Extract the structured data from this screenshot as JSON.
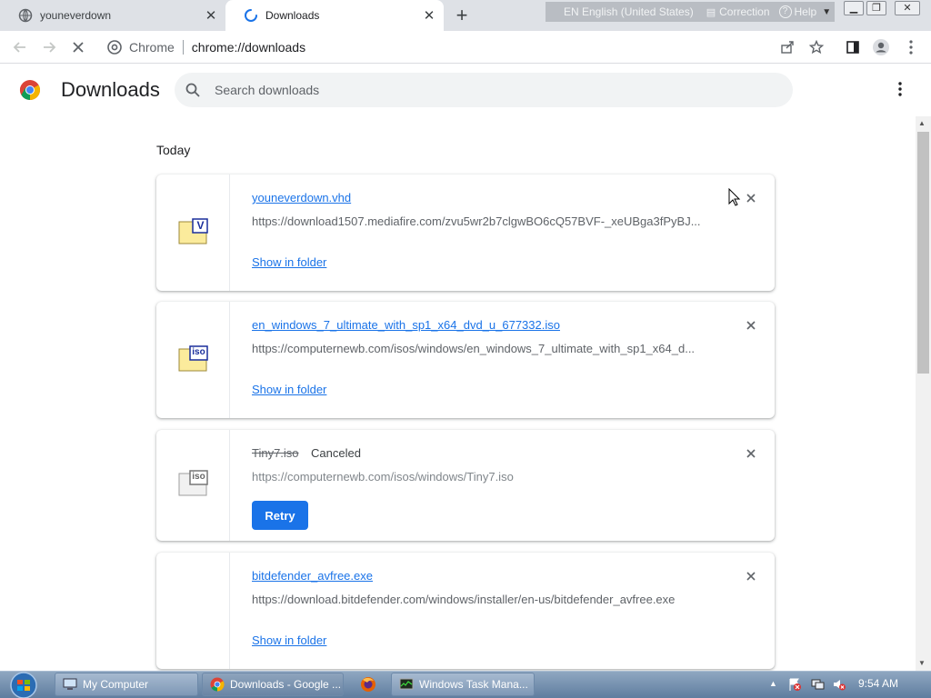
{
  "tabs": [
    {
      "title": "youneverdown",
      "active": false
    },
    {
      "title": "Downloads",
      "active": true
    }
  ],
  "language_bar": {
    "language": "EN English (United States)",
    "correction": "Correction",
    "help": "Help"
  },
  "toolbar": {
    "site_label": "Chrome",
    "url": "chrome://downloads"
  },
  "page": {
    "title": "Downloads",
    "search_placeholder": "Search downloads"
  },
  "section_label": "Today",
  "downloads": [
    {
      "filename": "youneverdown.vhd",
      "url": "https://download1507.mediafire.com/zvu5wr2b7clgwBO6cQ57BVF-_xeUBga3fPyBJ...",
      "action": "Show in folder",
      "icon_badge": "V",
      "state": "complete"
    },
    {
      "filename": "en_windows_7_ultimate_with_sp1_x64_dvd_u_677332.iso",
      "url": "https://computernewb.com/isos/windows/en_windows_7_ultimate_with_sp1_x64_d...",
      "action": "Show in folder",
      "icon_badge": "iso",
      "state": "complete"
    },
    {
      "filename": "Tiny7.iso",
      "status": "Canceled",
      "url": "https://computernewb.com/isos/windows/Tiny7.iso",
      "action": "Retry",
      "icon_badge": "iso",
      "state": "canceled"
    },
    {
      "filename": "bitdefender_avfree.exe",
      "url": "https://download.bitdefender.com/windows/installer/en-us/bitdefender_avfree.exe",
      "action": "Show in folder",
      "state": "complete"
    }
  ],
  "taskbar": {
    "items": [
      {
        "label": "My Computer"
      },
      {
        "label": "Downloads - Google ..."
      },
      {
        "label": ""
      },
      {
        "label": "Windows Task Mana..."
      }
    ],
    "clock": "9:54 AM"
  },
  "colors": {
    "accent": "#1a73e8",
    "tabstrip": "#dee1e6",
    "taskbar": "#6f8cad"
  }
}
